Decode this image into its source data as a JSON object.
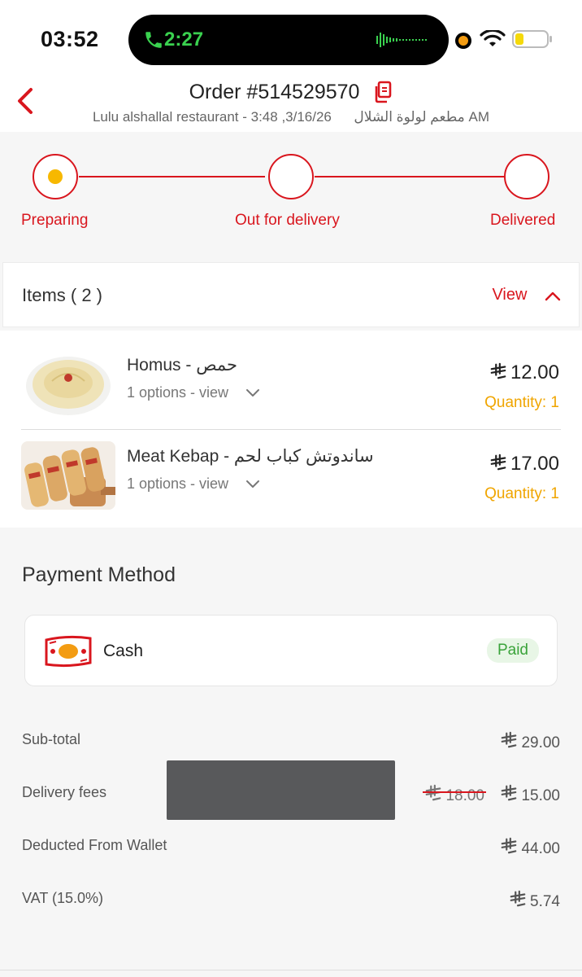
{
  "status_bar": {
    "time": "03:52",
    "call_time": "2:27"
  },
  "header": {
    "order_title": "Order #514529570",
    "restaurant": "Lulu alshallal restaurant - مطعم لولوة الشلال",
    "date": "3/16/26, 3:48 AM"
  },
  "progress": {
    "steps": [
      {
        "label": "Preparing",
        "active": true
      },
      {
        "label": "Out for delivery",
        "active": false
      },
      {
        "label": "Delivered",
        "active": false
      }
    ]
  },
  "items_section": {
    "title": "Items ( 2 )",
    "toggle_label": "View"
  },
  "items": [
    {
      "name": "Homus - حمص",
      "options": "1 options - view",
      "price": "12.00",
      "quantity": "Quantity: 1"
    },
    {
      "name": "Meat Kebap - ساندوتش كباب لحم",
      "options": "1 options - view",
      "price": "17.00",
      "quantity": "Quantity: 1"
    }
  ],
  "payment": {
    "title": "Payment Method",
    "method": "Cash",
    "status": "Paid"
  },
  "summary": {
    "subtotal_label": "Sub-total",
    "subtotal_value": "29.00",
    "delivery_label": "Delivery fees",
    "delivery_old": "18.00",
    "delivery_value": "15.00",
    "wallet_label": "Deducted From Wallet",
    "wallet_value": "44.00",
    "vat_label": "VAT (15.0%)",
    "vat_value": "5.74"
  },
  "colors": {
    "accent": "#d9161e",
    "quantity": "#f0a500",
    "paid_text": "#3aa33a",
    "paid_bg": "#e8f6e6",
    "progress_dot": "#f7b800"
  },
  "icons": [
    "phone-icon",
    "audio-wave-icon",
    "wifi-icon",
    "battery-icon",
    "back-arrow-icon",
    "copy-icon",
    "chevron-up-icon",
    "chevron-down-icon",
    "riyal-icon",
    "cash-icon"
  ]
}
